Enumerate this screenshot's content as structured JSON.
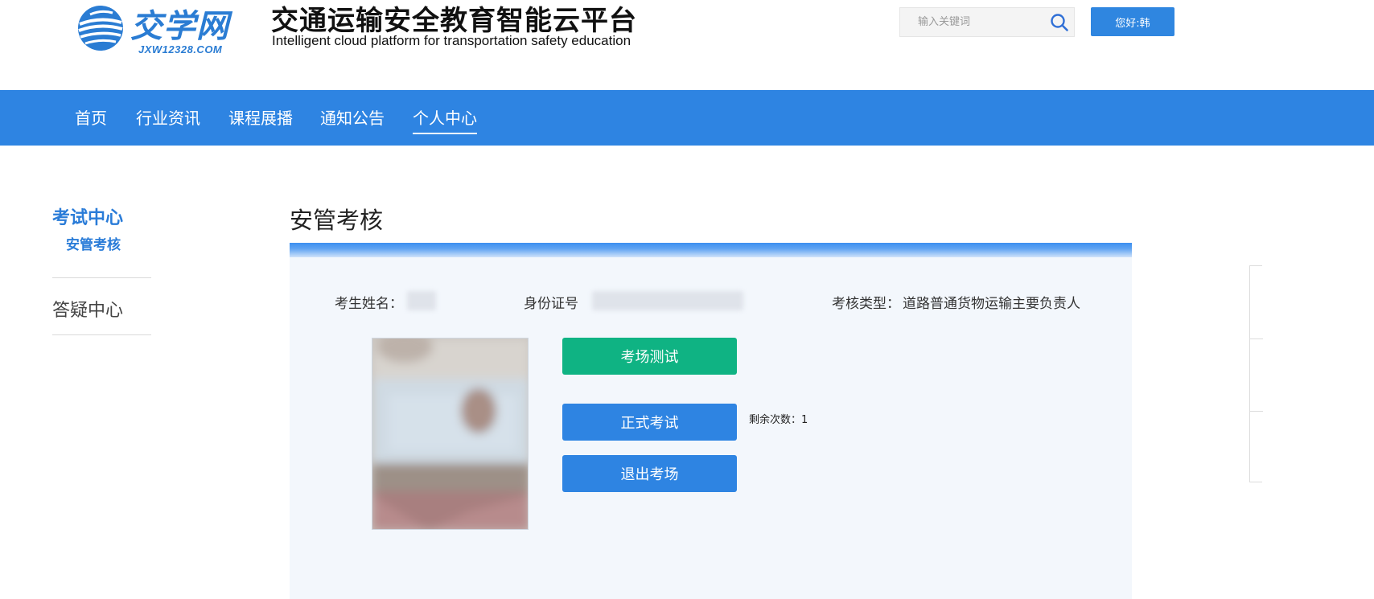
{
  "header": {
    "logo_text": "交学网",
    "logo_domain": "JXW12328.COM",
    "site_title": "交通运输安全教育智能云平台",
    "site_subtitle": "Intelligent cloud platform for transportation safety education",
    "search": {
      "placeholder": "输入关键词",
      "icon": "search-icon"
    },
    "user_button": "您好:韩"
  },
  "nav": {
    "items": [
      {
        "label": "首页"
      },
      {
        "label": "行业资讯"
      },
      {
        "label": "课程展播"
      },
      {
        "label": "通知公告"
      },
      {
        "label": "个人中心",
        "active": true
      }
    ]
  },
  "sidebar": {
    "section": "考试中心",
    "sub_item": "安管考核",
    "qa": "答疑中心"
  },
  "main": {
    "title": "安管考核",
    "info": {
      "name_label": "考生姓名：",
      "id_label": "身份证号",
      "type_label": "考核类型：",
      "type_value": "道路普通货物运输主要负责人"
    },
    "buttons": {
      "test_room": "考场测试",
      "formal_exam": "正式考试",
      "exit": "退出考场"
    },
    "remaining_label": "剩余次数：",
    "remaining_count": "1"
  },
  "colors": {
    "primary_blue": "#2e84e2",
    "green": "#0fb383",
    "panel_bg": "#f3f7fc",
    "accent_text": "#2a7cd8"
  }
}
